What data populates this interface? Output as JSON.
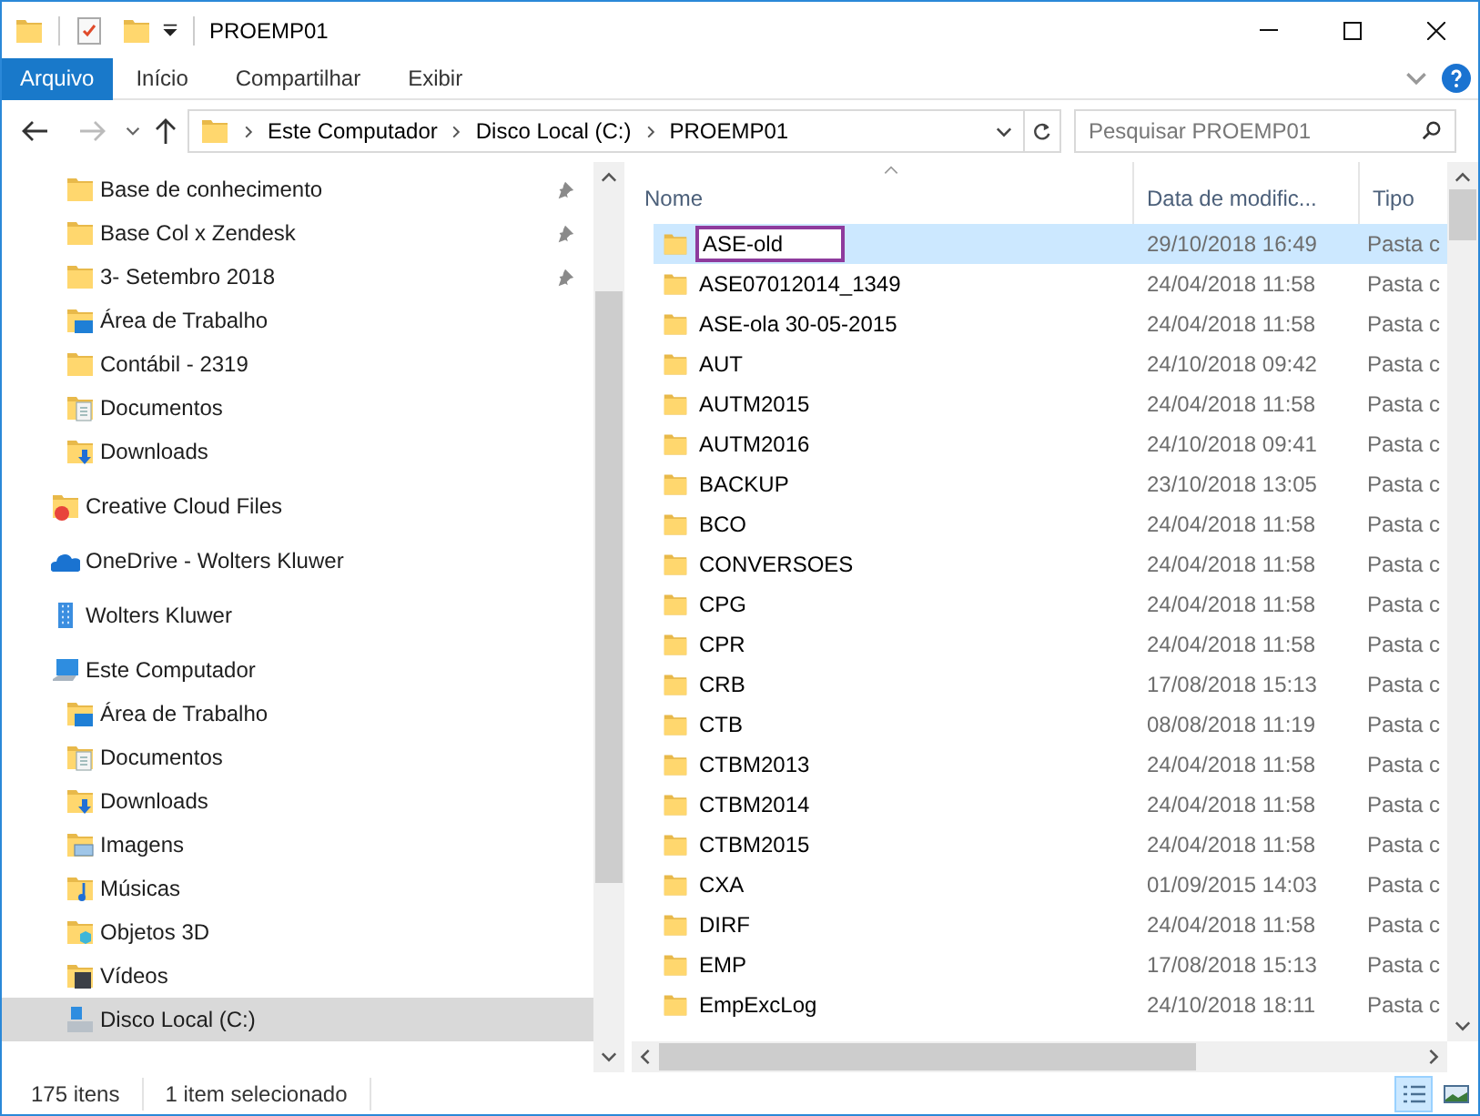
{
  "window": {
    "title": "PROEMP01"
  },
  "ribbon_tabs": [
    {
      "label": "Arquivo",
      "kind": "file-menu"
    },
    {
      "label": "Início",
      "kind": "tab"
    },
    {
      "label": "Compartilhar",
      "kind": "tab"
    },
    {
      "label": "Exibir",
      "kind": "tab"
    }
  ],
  "address": {
    "path": [
      "Este Computador",
      "Disco Local (C:)",
      "PROEMP01"
    ]
  },
  "search": {
    "placeholder": "Pesquisar PROEMP01"
  },
  "quick_access": [
    {
      "label": "Base de conhecimento",
      "kind": "folder",
      "pinned": true
    },
    {
      "label": "Base Col x Zendesk",
      "kind": "folder",
      "pinned": true
    },
    {
      "label": "3- Setembro 2018",
      "kind": "folder",
      "pinned": true
    },
    {
      "label": "Área de Trabalho",
      "kind": "desktop",
      "pinned": false
    },
    {
      "label": "Contábil - 2319",
      "kind": "folder",
      "pinned": false
    },
    {
      "label": "Documentos",
      "kind": "documents",
      "pinned": false
    },
    {
      "label": "Downloads",
      "kind": "downloads",
      "pinned": false
    }
  ],
  "locations": [
    {
      "label": "Creative Cloud Files",
      "kind": "creative-cloud",
      "selected": false
    },
    {
      "label": "OneDrive - Wolters Kluwer",
      "kind": "onedrive",
      "selected": false
    },
    {
      "label": "Wolters Kluwer",
      "kind": "building",
      "selected": false
    },
    {
      "label": "Este Computador",
      "kind": "computer",
      "selected": false,
      "children": [
        {
          "label": "Área de Trabalho",
          "kind": "desktop",
          "selected": false
        },
        {
          "label": "Documentos",
          "kind": "documents",
          "selected": false
        },
        {
          "label": "Downloads",
          "kind": "downloads",
          "selected": false
        },
        {
          "label": "Imagens",
          "kind": "pictures",
          "selected": false
        },
        {
          "label": "Músicas",
          "kind": "music",
          "selected": false
        },
        {
          "label": "Objetos 3D",
          "kind": "objects3d",
          "selected": false
        },
        {
          "label": "Vídeos",
          "kind": "videos",
          "selected": false
        },
        {
          "label": "Disco Local (C:)",
          "kind": "drive",
          "selected": true
        }
      ]
    }
  ],
  "table": {
    "columns": [
      {
        "label": "Nome",
        "sorted": true
      },
      {
        "label": "Data de modific...",
        "sorted": false
      },
      {
        "label": "Tipo",
        "sorted": false
      }
    ],
    "rows": [
      {
        "name": "ASE-old",
        "date": "29/10/2018 16:49",
        "type": "Pasta c",
        "selected": true,
        "renaming": true
      },
      {
        "name": "ASE07012014_1349",
        "date": "24/04/2018 11:58",
        "type": "Pasta c",
        "selected": false,
        "renaming": false
      },
      {
        "name": "ASE-ola 30-05-2015",
        "date": "24/04/2018 11:58",
        "type": "Pasta c",
        "selected": false,
        "renaming": false
      },
      {
        "name": "AUT",
        "date": "24/10/2018 09:42",
        "type": "Pasta c",
        "selected": false,
        "renaming": false
      },
      {
        "name": "AUTM2015",
        "date": "24/04/2018 11:58",
        "type": "Pasta c",
        "selected": false,
        "renaming": false
      },
      {
        "name": "AUTM2016",
        "date": "24/10/2018 09:41",
        "type": "Pasta c",
        "selected": false,
        "renaming": false
      },
      {
        "name": "BACKUP",
        "date": "23/10/2018 13:05",
        "type": "Pasta c",
        "selected": false,
        "renaming": false
      },
      {
        "name": "BCO",
        "date": "24/04/2018 11:58",
        "type": "Pasta c",
        "selected": false,
        "renaming": false
      },
      {
        "name": "CONVERSOES",
        "date": "24/04/2018 11:58",
        "type": "Pasta c",
        "selected": false,
        "renaming": false
      },
      {
        "name": "CPG",
        "date": "24/04/2018 11:58",
        "type": "Pasta c",
        "selected": false,
        "renaming": false
      },
      {
        "name": "CPR",
        "date": "24/04/2018 11:58",
        "type": "Pasta c",
        "selected": false,
        "renaming": false
      },
      {
        "name": "CRB",
        "date": "17/08/2018 15:13",
        "type": "Pasta c",
        "selected": false,
        "renaming": false
      },
      {
        "name": "CTB",
        "date": "08/08/2018 11:19",
        "type": "Pasta c",
        "selected": false,
        "renaming": false
      },
      {
        "name": "CTBM2013",
        "date": "24/04/2018 11:58",
        "type": "Pasta c",
        "selected": false,
        "renaming": false
      },
      {
        "name": "CTBM2014",
        "date": "24/04/2018 11:58",
        "type": "Pasta c",
        "selected": false,
        "renaming": false
      },
      {
        "name": "CTBM2015",
        "date": "24/04/2018 11:58",
        "type": "Pasta c",
        "selected": false,
        "renaming": false
      },
      {
        "name": "CXA",
        "date": "01/09/2015 14:03",
        "type": "Pasta c",
        "selected": false,
        "renaming": false
      },
      {
        "name": "DIRF",
        "date": "24/04/2018 11:58",
        "type": "Pasta c",
        "selected": false,
        "renaming": false
      },
      {
        "name": "EMP",
        "date": "17/08/2018 15:13",
        "type": "Pasta c",
        "selected": false,
        "renaming": false
      },
      {
        "name": "EmpExcLog",
        "date": "24/10/2018 18:11",
        "type": "Pasta c",
        "selected": false,
        "renaming": false
      }
    ]
  },
  "status_bar": {
    "item_count": "175 itens",
    "selection": "1 item selecionado",
    "view_modes": [
      {
        "kind": "details",
        "selected": true
      },
      {
        "kind": "large-icons",
        "selected": false
      }
    ]
  }
}
